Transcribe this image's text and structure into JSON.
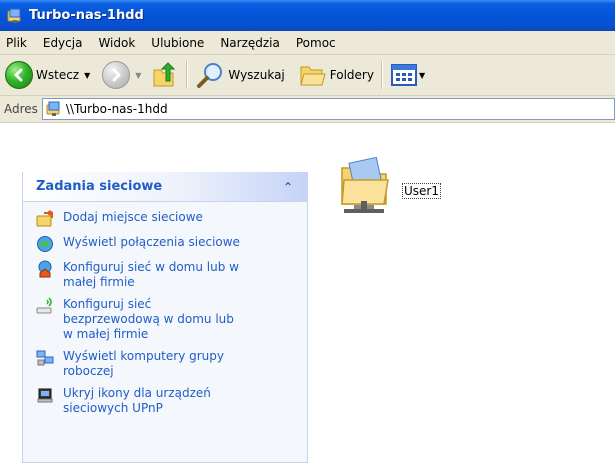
{
  "window": {
    "title": "Turbo-nas-1hdd"
  },
  "menu": {
    "items": [
      "Plik",
      "Edycja",
      "Widok",
      "Ulubione",
      "Narzędzia",
      "Pomoc"
    ]
  },
  "toolbar": {
    "back_label": "Wstecz",
    "search_label": "Wyszukaj",
    "folders_label": "Foldery"
  },
  "address": {
    "label": "Adres",
    "value": "\\\\Turbo-nas-1hdd"
  },
  "taskpane": {
    "title": "Zadania sieciowe",
    "tasks": [
      {
        "label": "Dodaj miejsce sieciowe",
        "icon": "add-network-place-icon"
      },
      {
        "label": "Wyświetl połączenia sieciowe",
        "icon": "network-connections-icon"
      },
      {
        "label": "Konfiguruj sieć w domu lub w\nmałej firmie",
        "icon": "home-network-icon"
      },
      {
        "label": "Konfiguruj sieć\nbezprzewodową w domu lub\nw małej firmie",
        "icon": "wireless-network-icon"
      },
      {
        "label": "Wyświetl komputery grupy\nroboczej",
        "icon": "workgroup-computers-icon"
      },
      {
        "label": "Ukryj ikony dla urządzeń\nsieciowych UPnP",
        "icon": "upnp-device-icon"
      }
    ]
  },
  "files": [
    {
      "name": "User1",
      "icon": "shared-folder-icon"
    }
  ],
  "colors": {
    "titlebar": "#0553d8",
    "link": "#215dc6",
    "chrome": "#ece9d8"
  }
}
